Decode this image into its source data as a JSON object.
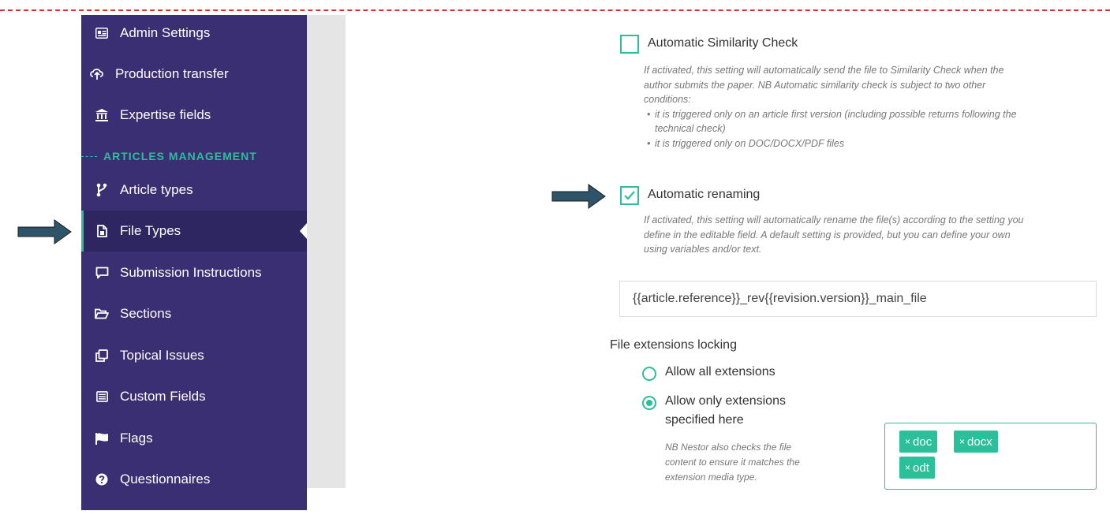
{
  "sidebar": {
    "items_top": [
      {
        "label": "Admin Settings",
        "icon": "admin-card-icon"
      },
      {
        "label": "Production transfer",
        "icon": "transfer-icon"
      },
      {
        "label": "Expertise fields",
        "icon": "bank-icon"
      }
    ],
    "section_heading": "ARTICLES MANAGEMENT",
    "items": [
      {
        "label": "Article types",
        "icon": "branch-icon"
      },
      {
        "label": "File Types",
        "icon": "file-icon",
        "active": true
      },
      {
        "label": "Submission Instructions",
        "icon": "comment-icon"
      },
      {
        "label": "Sections",
        "icon": "folder-open-icon"
      },
      {
        "label": "Topical Issues",
        "icon": "clone-icon"
      },
      {
        "label": "Custom Fields",
        "icon": "list-icon"
      },
      {
        "label": "Flags",
        "icon": "flag-icon"
      },
      {
        "label": "Questionnaires",
        "icon": "question-circle-icon"
      }
    ]
  },
  "main": {
    "similarity": {
      "label": "Automatic Similarity Check",
      "checked": false,
      "help_line1": "If activated, this setting will automatically send the file to Similarity Check when the",
      "help_line2": "author submits the paper. NB Automatic similarity check is subject to two other",
      "help_line3": "conditions:",
      "bullet1_line1": "it is triggered only on an article first version (including possible returns following the",
      "bullet1_line2": "technical check)",
      "bullet2": "it is triggered only on DOC/DOCX/PDF files"
    },
    "renaming": {
      "label": "Automatic renaming",
      "checked": true,
      "help_line1": "If activated, this setting will automatically rename the file(s) according to the setting you",
      "help_line2": "define in the editable field. A default setting is provided, but you can define your own",
      "help_line3": "using variables and/or text.",
      "pattern_value": "{{article.reference}}_rev{{revision.version}}_main_file"
    },
    "extensions": {
      "title": "File extensions locking",
      "option_all": "Allow all extensions",
      "option_only_line1": "Allow only extensions",
      "option_only_line2": "specified here",
      "selected": "only",
      "note_line1": "NB Nestor also checks the file",
      "note_line2": "content to ensure it matches the",
      "note_line3": "extension media type.",
      "tags": [
        "doc",
        "docx",
        "odt"
      ],
      "tag_remove": "×"
    }
  },
  "colors": {
    "sidebar_bg": "#3a2f72",
    "sidebar_active_bg": "#2e2660",
    "accent": "#2bbf9a",
    "arrow": "#2d5468",
    "guide_dashes": "#e0303a"
  }
}
